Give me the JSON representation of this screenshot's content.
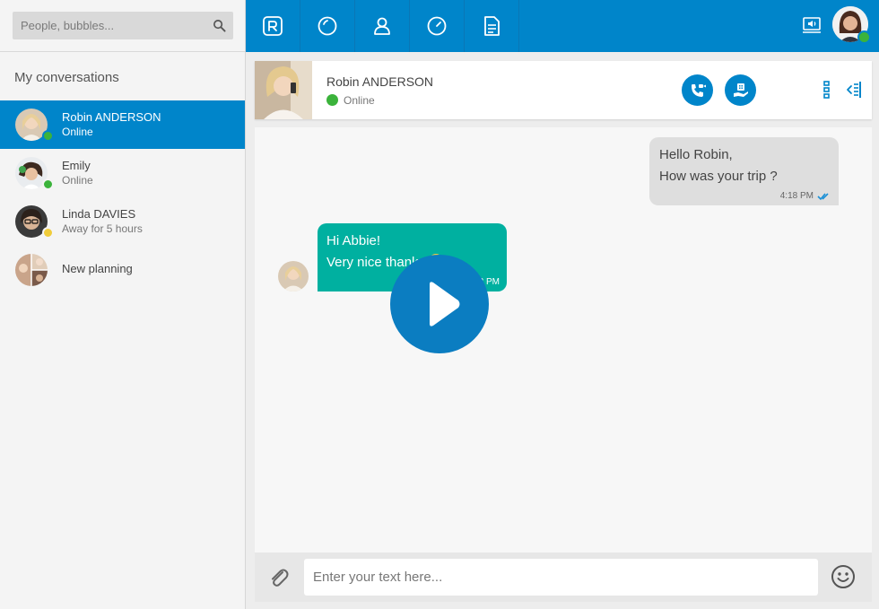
{
  "search": {
    "placeholder": "People, bubbles..."
  },
  "sidebar": {
    "title": "My conversations",
    "conversations": [
      {
        "name": "Robin ANDERSON",
        "status": "Online",
        "presence": "online",
        "active": true
      },
      {
        "name": "Emily",
        "status": "Online",
        "presence": "online",
        "active": false
      },
      {
        "name": "Linda DAVIES",
        "status": "Away for 5 hours",
        "presence": "away",
        "active": false
      },
      {
        "name": "New planning",
        "status": "",
        "presence": "",
        "active": false
      }
    ]
  },
  "topbar": {
    "icons": [
      "rainbow-logo-icon",
      "recent-icon",
      "contacts-icon",
      "clock-icon",
      "document-icon"
    ],
    "right_icon": "speaker-screen-icon"
  },
  "header": {
    "name": "Robin ANDERSON",
    "status": "Online",
    "actions": [
      "phone-video-icon",
      "conference-icon",
      "more-vertical-icon",
      "collapse-panel-icon"
    ]
  },
  "messages": [
    {
      "direction": "out",
      "lines": [
        "Hello Robin,",
        "How was your trip ?"
      ],
      "time": "4:18 PM",
      "read": true
    },
    {
      "direction": "in",
      "lines": [
        "Hi Abbie!",
        "Very nice thanks"
      ],
      "time": "4:18 PM"
    }
  ],
  "composer": {
    "placeholder": "Enter your text here..."
  },
  "colors": {
    "accent": "#0085ca",
    "incoming_bubble": "#00b0a0",
    "outgoing_bubble": "#dedede",
    "online": "#3bb33b",
    "away": "#f0cc3a"
  }
}
